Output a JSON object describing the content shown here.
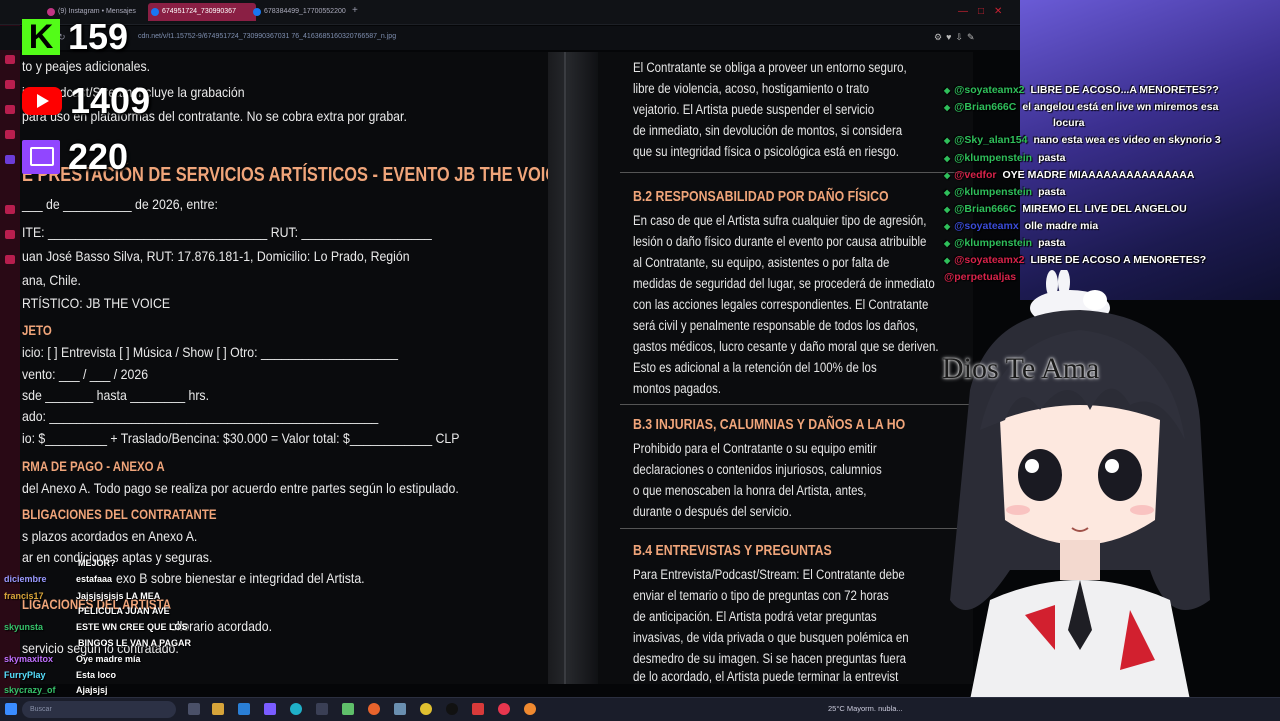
{
  "browser": {
    "tabs": [
      {
        "label": "(9) Instagram • Mensajes",
        "color": "#c13584"
      },
      {
        "label": "674951724_730990367",
        "color": "#1877f2"
      },
      {
        "label": "678384499_17700552200",
        "color": "#1877f2"
      }
    ],
    "new_tab": "+",
    "url": "cdn.net/v/t1.15752-9/674951724_730990367031 76_4163685160320766587_n.jpg"
  },
  "counters": {
    "kick": "159",
    "kick_logo": "K",
    "youtube": "1409",
    "twitch": "220"
  },
  "doc_left": {
    "lines": [
      "to y peajes adicionales.",
      "ista/Podcast/Stream incluye la grabación",
      "para uso en plataformas del contratante. No se cobra extra por grabar.",
      "E PRESTACIÓN DE SERVICIOS ARTÍSTICOS - EVENTO JB THE VOICE",
      "___ de __________ de 2026, entre:",
      "ITE: ________________________________     RUT: ___________________",
      "uan José Basso Silva, RUT: 17.876.181-1, Domicilio: Lo Prado, Región",
      "ana, Chile.",
      "RTÍSTICO: JB THE VOICE",
      "JETO",
      "icio: [  ] Entrevista   [  ] Música / Show   [  ] Otro: ____________________",
      "vento: ___ / ___ / 2026",
      "sde _______ hasta ________ hrs.",
      "ado: ________________________________________________",
      "io: $_________ + Traslado/Bencina: $30.000 = Valor total: $____________  CLP",
      "RMA DE PAGO - ANEXO A",
      "del Anexo A. Todo pago se realiza por acuerdo entre partes según lo estipulado.",
      "BLIGACIONES DEL CONTRATANTE",
      "s plazos acordados en Anexo A.",
      "ar en condiciones aptas y seguras.",
      "exo B sobre bienestar e integridad del Artista.",
      "LIGACIONES DEL ARTISTA",
      "ollorario acordado.",
      "servicio según lo contratado."
    ]
  },
  "doc_right": {
    "lines": [
      "El Contratante se obliga a proveer un entorno seguro,",
      "libre de violencia, acoso, hostigamiento o trato",
      "vejatorio. El Artista puede suspender el servicio",
      "de inmediato, sin devolución de montos, si considera",
      "que su integridad física o psicológica está en riesgo.",
      "B.2 RESPONSABILIDAD POR DAÑO FÍSICO",
      "En caso de que el Artista sufra cualquier tipo de agresión,",
      "lesión o daño físico durante el evento por causa atribuible",
      "al Contratante, su equipo, asistentes o por falta de",
      "medidas de seguridad del lugar, se procederá de inmediato",
      "con las acciones legales correspondientes. El Contratante",
      "será civil y penalmente responsable de todos los daños,",
      "gastos médicos, lucro cesante y daño moral que se deriven.",
      "Esto es adicional a la retención del 100% de los",
      "montos pagados.",
      "B.3 INJURIAS, CALUMNIAS Y DAÑOS A LA HO",
      "Prohibido para el Contratante o su equipo emitir",
      "declaraciones o contenidos injuriosos, calumnios",
      "o que menoscaben la honra del Artista, antes,",
      "durante o después del servicio.",
      "B.4 ENTREVISTAS Y PREGUNTAS",
      "Para Entrevista/Podcast/Stream: El Contratante debe",
      "enviar el temario o tipo de preguntas con 72 horas",
      "de anticipación. El Artista podrá vetar preguntas",
      "invasivas, de vida privada o que busquen polémica en",
      "desmedro de su imagen. Si se hacen preguntas fuera",
      "de lo acordado, el Artista puede terminar la entrevist"
    ]
  },
  "chat_right": [
    {
      "user": "@soyateamx2",
      "text": "LIBRE DE ACOSO...A MENORETES??"
    },
    {
      "user": "@Brian666C",
      "text": "el angelou está en live wn miremos esa"
    },
    {
      "user": "",
      "text": "locura"
    },
    {
      "user": "@Sky_alan154",
      "text": "nano esta wea es video en skynorio 3"
    },
    {
      "user": "@klumpenstein",
      "text": "pasta"
    },
    {
      "user": "@vedfor",
      "text": "OYE MADRE MIAAAAAAAAAAAAAAA"
    },
    {
      "user": "@klumpenstein",
      "text": "pasta"
    },
    {
      "user": "@Brian666C",
      "text": "MIREMO EL LIVE DEL ANGELOU"
    },
    {
      "user": "@soyateamx",
      "text": "olle madre mia"
    },
    {
      "user": "@klumpenstein",
      "text": "pasta"
    },
    {
      "user": "@soyateamx2",
      "text": "LIBRE DE ACOSO A MENORETES?"
    },
    {
      "user": "@perpetualjas",
      "text": ""
    }
  ],
  "overlay_text": "Dios Te Ama",
  "chat_left": [
    {
      "user": "",
      "text": "MEJOR?"
    },
    {
      "user": "diciembre",
      "text": "estafaaa"
    },
    {
      "user": "francis17",
      "text": "Jajsjsjsjsjs LA MEA"
    },
    {
      "user": "",
      "text": "PELICULA JUAN AVE"
    },
    {
      "user": "skyunsta",
      "text": "ESTE WN CREE QUE LOS"
    },
    {
      "user": "",
      "text": "BINGOS LE VAN A PAGAR"
    },
    {
      "user": "skymaxitox",
      "text": "Oye madre mía"
    },
    {
      "user": "FurryPlay",
      "text": "Esta loco"
    },
    {
      "user": "skycrazy_of",
      "text": "Ajajsjsj"
    }
  ],
  "taskbar": {
    "search_placeholder": "Buscar",
    "weather": "25°C  Mayorm. nubla..."
  },
  "colors": {
    "accent_pink": "#8a1f44",
    "heading_orange": "#f0a57a",
    "chat_user_green": "#2fbf5b",
    "kick_green": "#53fc18",
    "youtube_red": "#ff0000",
    "twitch_purple": "#9146ff"
  }
}
